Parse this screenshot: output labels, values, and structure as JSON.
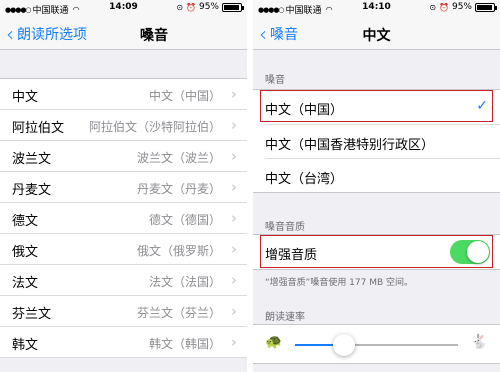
{
  "left": {
    "status": {
      "carrier": "中国联通",
      "time": "14:09",
      "battery_text": "95%",
      "battery_level": 0.95
    },
    "nav": {
      "back_label": "朗读所选项",
      "title": "嗓音"
    },
    "voices": [
      {
        "name": "中文",
        "detail": "中文（中国）"
      },
      {
        "name": "阿拉伯文",
        "detail": "阿拉伯文（沙特阿拉伯）"
      },
      {
        "name": "波兰文",
        "detail": "波兰文（波兰）"
      },
      {
        "name": "丹麦文",
        "detail": "丹麦文（丹麦）"
      },
      {
        "name": "德文",
        "detail": "德文（德国）"
      },
      {
        "name": "俄文",
        "detail": "俄文（俄罗斯）"
      },
      {
        "name": "法文",
        "detail": "法文（法国）"
      },
      {
        "name": "芬兰文",
        "detail": "芬兰文（芬兰）"
      },
      {
        "name": "韩文",
        "detail": "韩文（韩国）"
      }
    ]
  },
  "right": {
    "status": {
      "carrier": "中国联通",
      "time": "14:10",
      "battery_text": "95%",
      "battery_level": 0.95
    },
    "nav": {
      "back_label": "嗓音",
      "title": "中文"
    },
    "voice_section_header": "嗓音",
    "voice_options": [
      {
        "label": "中文（中国）",
        "selected": true
      },
      {
        "label": "中文（中国香港特别行政区）",
        "selected": false
      },
      {
        "label": "中文（台湾）",
        "selected": false
      }
    ],
    "quality_section_header": "嗓音音质",
    "enhanced_quality": {
      "label": "增强音质",
      "enabled": true
    },
    "quality_footnote": "“增强音质”嗓音使用 177 MB 空间。",
    "speed_section_header": "朗读速率",
    "speaking_rate": 0.3
  },
  "colors": {
    "accent": "#157efb",
    "toggle_on": "#4cd964",
    "highlight": "#c8202a"
  },
  "icons": {
    "slow": "turtle-icon",
    "fast": "rabbit-icon",
    "check": "checkmark-icon",
    "chevron": "chevron-right-icon"
  }
}
